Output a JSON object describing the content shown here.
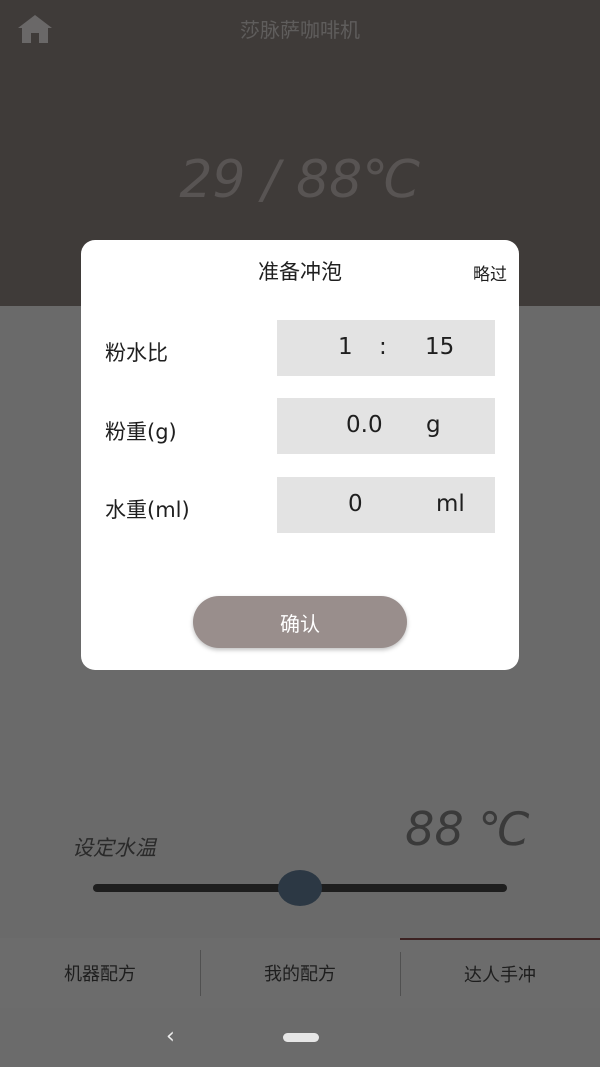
{
  "header": {
    "title": "莎脉萨咖啡机",
    "temperature_display": "29 / 88℃",
    "home_icon": "home-icon"
  },
  "dialog": {
    "title": "准备冲泡",
    "skip_label": "略过",
    "ratio": {
      "label": "粉水比",
      "left": "1",
      "separator": ":",
      "right": "15"
    },
    "powder_weight": {
      "label": "粉重(g)",
      "value": "0.0",
      "unit": "g"
    },
    "water_weight": {
      "label": "水重(ml)",
      "value": "0",
      "unit": "ml"
    },
    "confirm_label": "确认"
  },
  "water_temp": {
    "label": "设定水温",
    "value_text": "88 ℃",
    "slider_value": 88
  },
  "tabs": [
    {
      "label": "机器配方",
      "active": false
    },
    {
      "label": "我的配方",
      "active": false
    },
    {
      "label": "达人手冲",
      "active": true
    }
  ],
  "nav": {
    "back_icon": "back-chevron-icon",
    "home_pill": "home-pill-icon"
  }
}
